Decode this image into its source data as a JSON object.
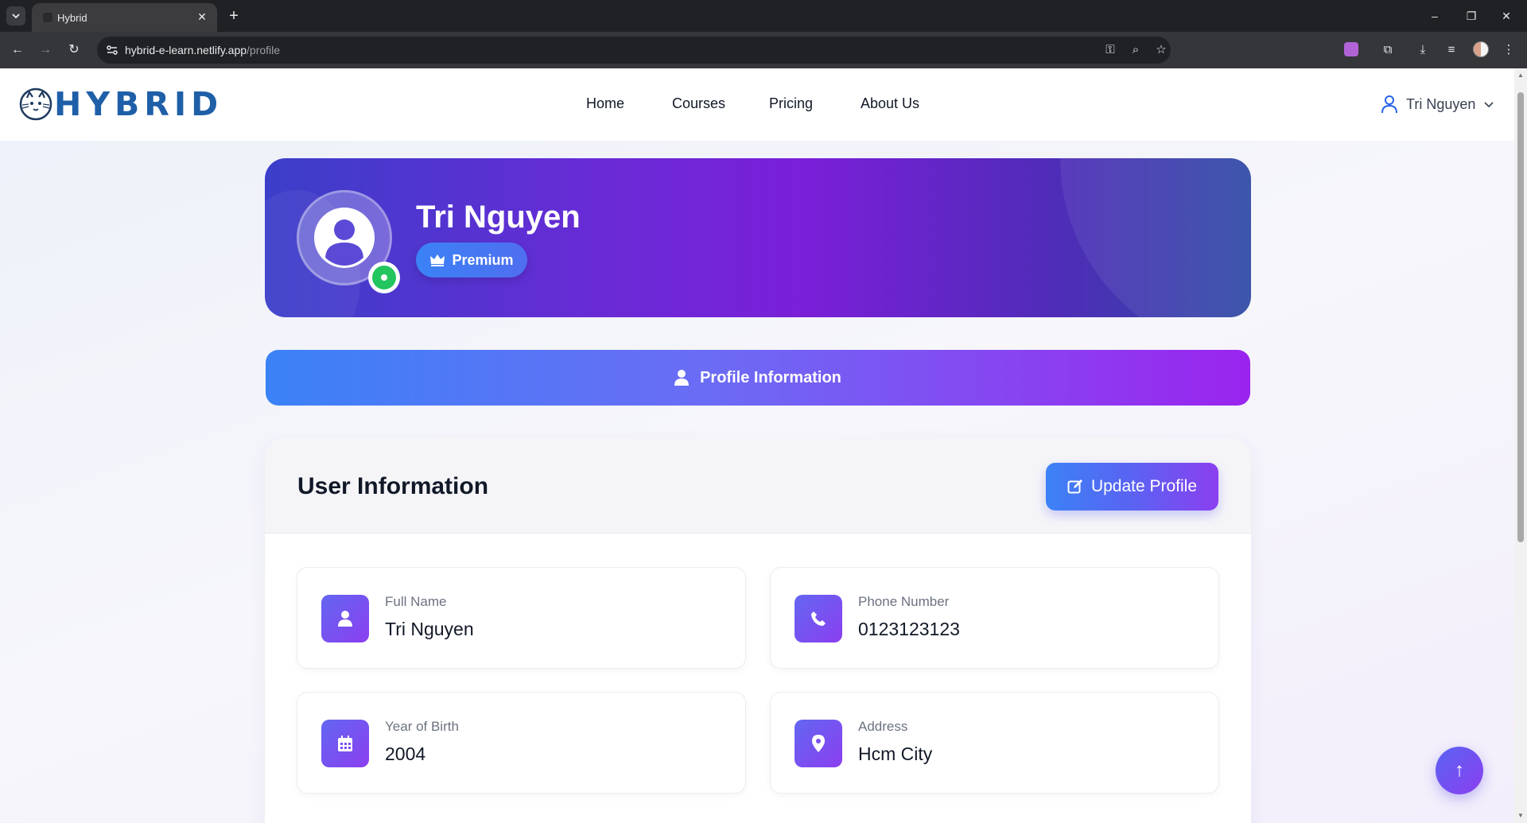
{
  "browser": {
    "tab_title": "Hybrid",
    "url_host": "hybrid-e-learn.netlify.app",
    "url_path": "/profile"
  },
  "header": {
    "logo_text": "HYBRID",
    "nav": [
      "Home",
      "Courses",
      "Pricing",
      "About Us"
    ],
    "user_name": "Tri Nguyen"
  },
  "banner": {
    "name": "Tri Nguyen",
    "badge": "Premium"
  },
  "tab": {
    "label": "Profile Information"
  },
  "info": {
    "title": "User Information",
    "update_button": "Update Profile",
    "fields": [
      {
        "label": "Full Name",
        "value": "Tri Nguyen",
        "icon": "user-icon"
      },
      {
        "label": "Phone Number",
        "value": "0123123123",
        "icon": "phone-icon"
      },
      {
        "label": "Year of Birth",
        "value": "2004",
        "icon": "calendar-icon"
      },
      {
        "label": "Address",
        "value": "Hcm City",
        "icon": "map-pin-icon"
      }
    ]
  },
  "colors": {
    "brand": "#1f5fa8",
    "accent_blue": "#3b82f6",
    "accent_purple": "#8b3ff0",
    "online": "#22c55e"
  }
}
